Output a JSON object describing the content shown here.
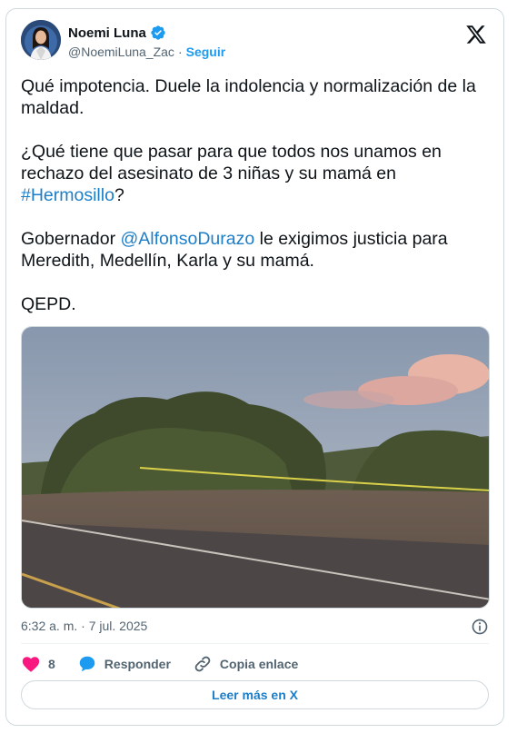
{
  "author": {
    "name": "Noemi Luna",
    "handle": "@NoemiLuna_Zac",
    "separator": "·",
    "follow_label": "Seguir"
  },
  "tweet": {
    "p1": "Qué impotencia. Duele la indolencia y normalización de la maldad.",
    "p2_before": "¿Qué tiene que pasar para que todos nos unamos en rechazo del asesinato de 3 niñas y su mamá en ",
    "p2_hashtag": "#Hermosillo",
    "p2_after": "?",
    "p3_before": "Gobernador ",
    "p3_mention": "@AlfonsoDurazo",
    "p3_after": " le exigimos justicia para Meredith, Medellín, Karla y su mamá.",
    "p4": "QEPD."
  },
  "meta": {
    "timestamp": "6:32 a. m. · 7 jul. 2025"
  },
  "actions": {
    "like_count": "8",
    "reply_label": "Responder",
    "copy_label": "Copia enlace"
  },
  "read_more_label": "Leer más en X",
  "colors": {
    "link": "#1d7ec8",
    "like": "#f91880",
    "reply": "#1d9bf0",
    "muted": "#536471"
  }
}
